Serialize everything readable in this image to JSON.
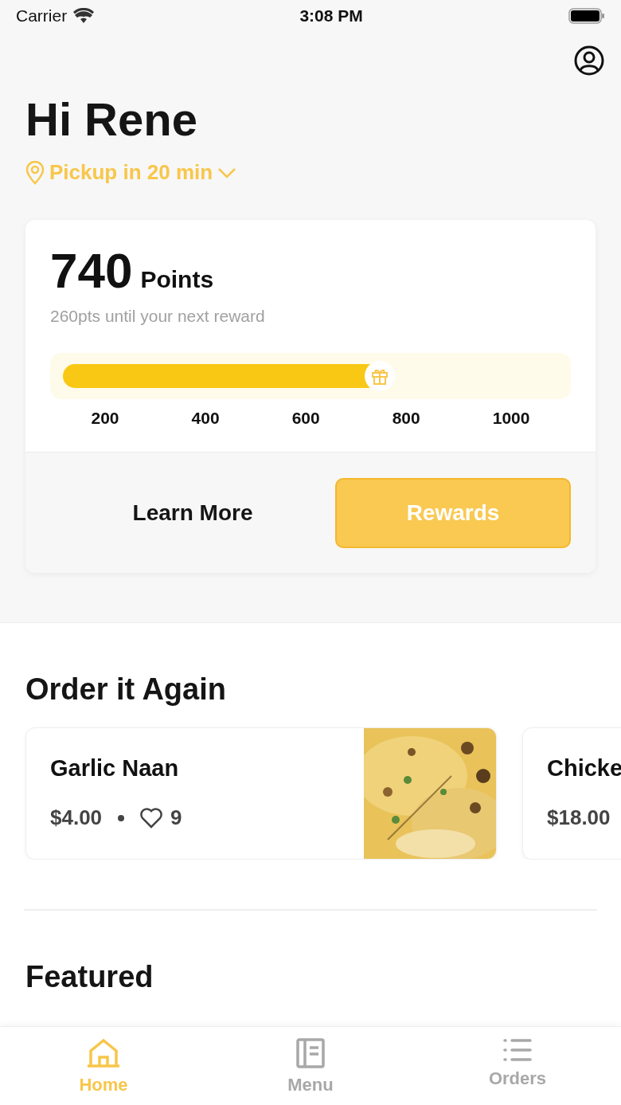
{
  "status_bar": {
    "carrier": "Carrier",
    "time": "3:08 PM"
  },
  "greeting": "Hi Rene",
  "pickup": "Pickup in 20 min",
  "rewards_card": {
    "points": "740",
    "points_label": "Points",
    "subtitle": "260pts until your next reward",
    "level": 0.64,
    "ticks": [
      "200",
      "400",
      "600",
      "800",
      "1000"
    ],
    "learn_more": "Learn More",
    "rewards_button": "Rewards"
  },
  "order_again": {
    "title": "Order it Again",
    "items": [
      {
        "name": "Garlic Naan",
        "price": "$4.00",
        "likes": "9",
        "kind": "picture"
      },
      {
        "name": "Chicke",
        "price": "$18.00"
      }
    ]
  },
  "featured": {
    "title": "Featured"
  },
  "tab_bar": [
    {
      "label": "Home",
      "selected": true,
      "kind": "home"
    },
    {
      "label": "Menu",
      "selected": false,
      "kind": "menu"
    },
    {
      "label": "Orders",
      "selected": false,
      "kind": "orders"
    }
  ]
}
